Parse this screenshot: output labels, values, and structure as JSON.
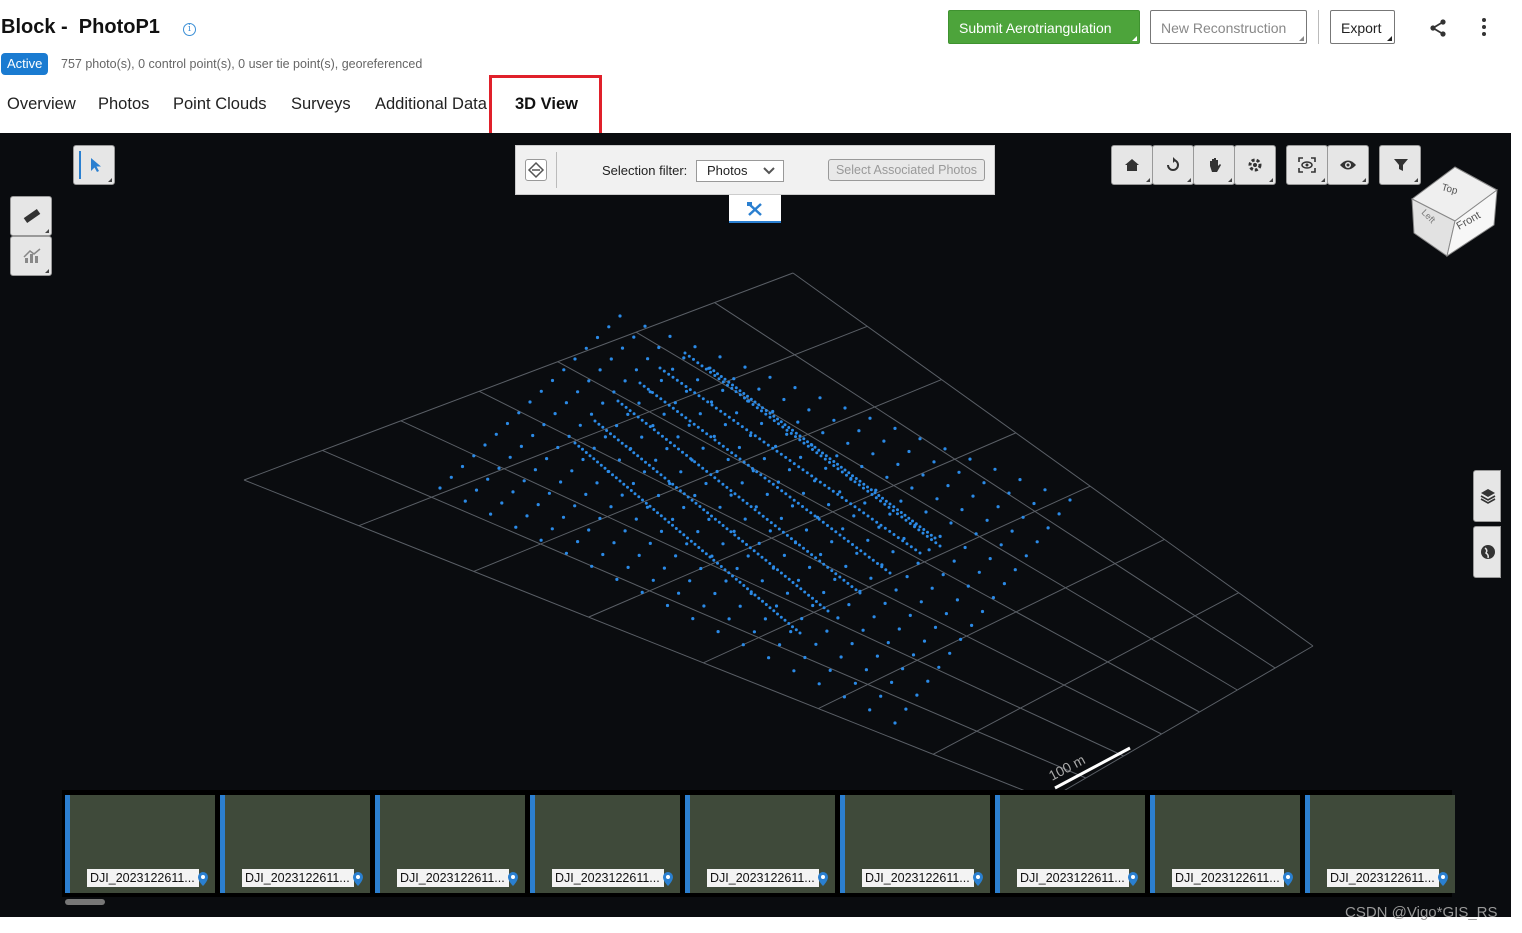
{
  "header": {
    "title": "Block -  PhotoP1",
    "status_badge": "Active",
    "status_text": "757 photo(s), 0 control point(s), 0 user tie point(s), georeferenced",
    "buttons": {
      "submit": "Submit Aerotriangulation",
      "new_reconstruction": "New Reconstruction",
      "export": "Export"
    }
  },
  "tabs": [
    {
      "label": "Overview"
    },
    {
      "label": "Photos"
    },
    {
      "label": "Point Clouds"
    },
    {
      "label": "Surveys"
    },
    {
      "label": "Additional Data"
    },
    {
      "label": "3D View"
    }
  ],
  "viewer": {
    "selection_filter_label": "Selection filter:",
    "selection_filter_value": "Photos",
    "select_associated": "Select Associated Photos",
    "scale_label": "100 m",
    "cube": {
      "top": "Top",
      "front": "Front",
      "left": "Left"
    }
  },
  "filmstrip": {
    "items": [
      {
        "label": "DJI_2023122611..."
      },
      {
        "label": "DJI_2023122611..."
      },
      {
        "label": "DJI_2023122611..."
      },
      {
        "label": "DJI_2023122611..."
      },
      {
        "label": "DJI_2023122611..."
      },
      {
        "label": "DJI_2023122611..."
      },
      {
        "label": "DJI_2023122611..."
      },
      {
        "label": "DJI_2023122611..."
      },
      {
        "label": "DJI_2023122611..."
      }
    ]
  },
  "watermark": "CSDN @Vigo*GIS_RS",
  "icons": {
    "info": "info-icon",
    "share": "share-icon",
    "more": "more-vertical-icon",
    "select_tool": "select-cursor-icon",
    "measure": "ruler-icon",
    "profile": "chart-icon",
    "home": "home-icon",
    "orbit": "orbit-icon",
    "pan": "hand-icon",
    "settings": "gear-icon",
    "focus": "focus-icon",
    "visibility": "eye-icon",
    "filter": "filter-icon",
    "layers": "layers-icon",
    "globe": "globe-icon",
    "tools": "tools-icon"
  },
  "colors": {
    "accent": "#1a7bd1",
    "primary_button": "#4da43b",
    "viewport_bg": "#0a0c0f",
    "camera_points": "#2b8ae6",
    "highlight": "#e0202a"
  }
}
